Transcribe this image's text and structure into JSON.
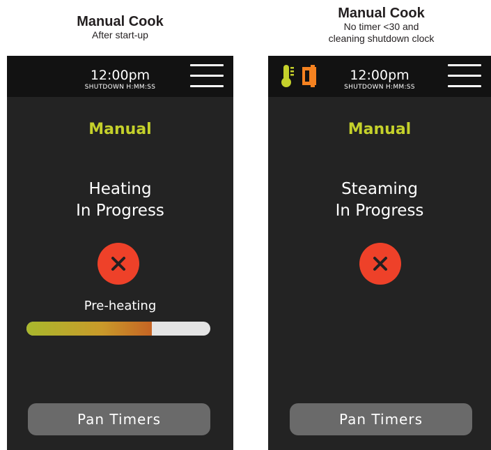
{
  "left": {
    "caption_title": "Manual Cook",
    "caption_sub": "After start-up",
    "clock": "12:00pm",
    "shutdown": "SHUTDOWN H:MM:SS",
    "mode": "Manual",
    "status_line1": "Heating",
    "status_line2": "In Progress",
    "preheat_label": "Pre-heating",
    "preheat_progress": 0.68,
    "pan_timers": "Pan Timers"
  },
  "right": {
    "caption_title": "Manual Cook",
    "caption_sub1": "No timer <30 and",
    "caption_sub2": "cleaning shutdown clock",
    "clock": "12:00pm",
    "shutdown": "SHUTDOWN H:MM:SS",
    "mode": "Manual",
    "status_line1": "Steaming",
    "status_line2": "In Progress",
    "pan_timers": "Pan Timers",
    "status_icons": [
      "thermometer-icon",
      "door-icon"
    ]
  },
  "colors": {
    "accent_mode": "#c5d12b",
    "cancel": "#ee4129",
    "thermometer": "#c5d12b",
    "door": "#f58220",
    "screen_bg": "#232323",
    "topbar_bg": "#121212"
  }
}
